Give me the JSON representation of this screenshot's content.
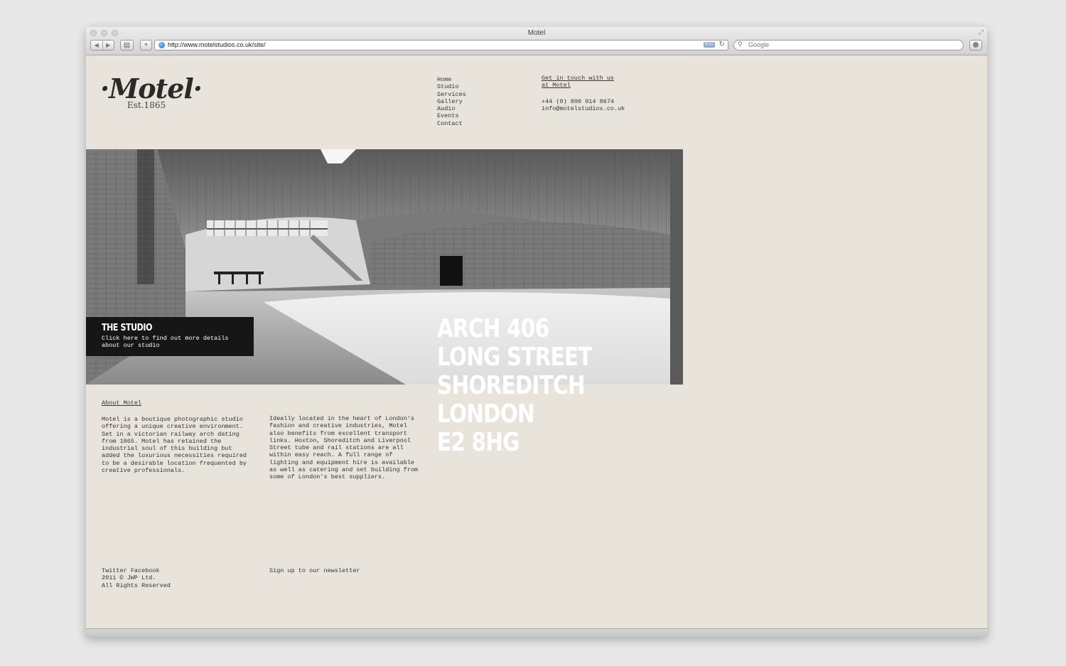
{
  "browser": {
    "title": "Motel",
    "url": "http://www.motelstudios.co.uk/site/",
    "rss_label": "RSS",
    "search_placeholder": "Google"
  },
  "logo": {
    "word": "·Motel·",
    "est": "Est.1865"
  },
  "nav": [
    "Home",
    "Studio",
    "Services",
    "Gallery",
    "Audio",
    "Events",
    "Contact"
  ],
  "contact": {
    "link_line1": "Get in touch with us",
    "link_line2": "at Motel",
    "phone": "+44 (0) 800 014 8674",
    "email": "info@motelstudios.co.uk"
  },
  "studio_panel": {
    "title": "THE STUDIO",
    "desc_line1": "Click here to find out more details",
    "desc_line2": "about our studio"
  },
  "address": [
    "ARCH 406",
    "LONG STREET",
    "SHOREDITCH",
    "LONDON",
    "E2 8HG"
  ],
  "about": {
    "link": "About Motel",
    "col1": [
      "Motel is a boutique photographic studio",
      "offering a unique creative environment.",
      "Set in a victorian railway arch dating",
      "from 1865. Motel has retained the",
      "industrial soul of this building but",
      "added the luxurious necessities required",
      "to be a desirable location frequented by",
      "creative professionals."
    ],
    "col2": [
      "Ideally located in the heart of London's",
      "fashion and creative industries, Motel",
      "also benefits from excellent transport",
      "links. Hoxton, Shoreditch and Liverpool",
      "Street tube and rail stations are all",
      "within easy reach. A full range of",
      "lighting and equipment hire is available",
      "as well as catering and set building from",
      "some of London's best suppliers."
    ]
  },
  "footer": {
    "twitter": "Twitter",
    "facebook": "Facebook",
    "copyright": "2011 © JWP Ltd.",
    "rights": "All Rights Reserved",
    "newsletter": "Sign up to our newsletter"
  }
}
